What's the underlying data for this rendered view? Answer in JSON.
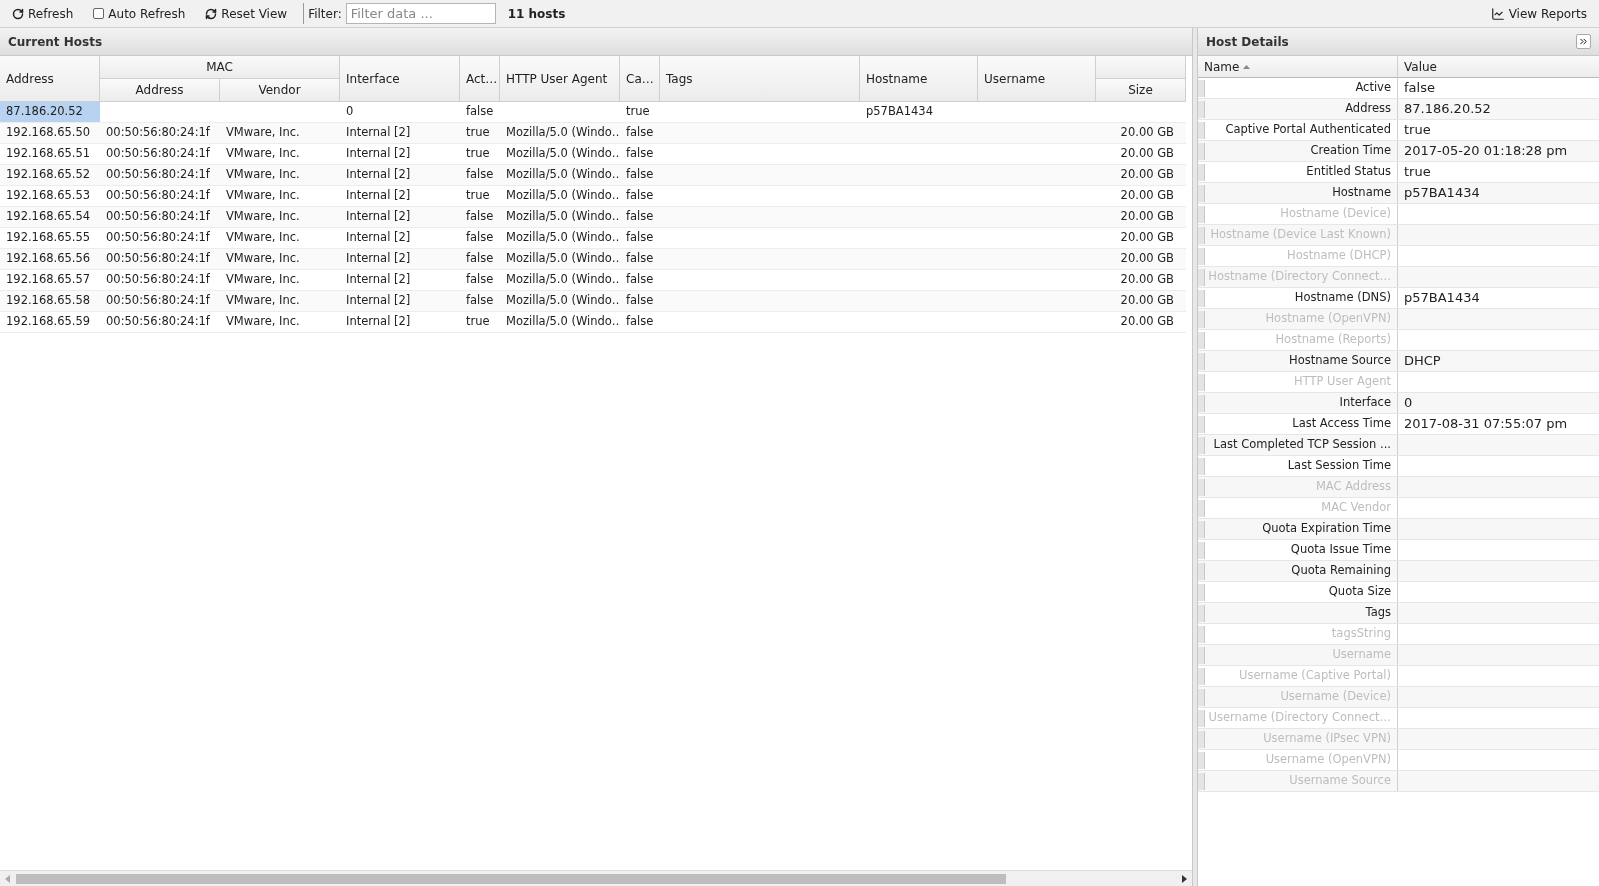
{
  "toolbar": {
    "refresh": "Refresh",
    "auto_refresh": {
      "label": "Auto Refresh",
      "checked": false
    },
    "reset_view": "Reset View",
    "filter_label": "Filter:",
    "filter": {
      "placeholder": "Filter data ..."
    },
    "host_count": "11 hosts",
    "view_reports": "View Reports"
  },
  "hosts_panel": {
    "title": "Current Hosts",
    "column_groups": [
      {
        "label": "MAC"
      }
    ],
    "columns": [
      {
        "label": "Address",
        "kind": "single"
      },
      {
        "label": "Address",
        "kind": "sub"
      },
      {
        "label": "Vendor",
        "kind": "sub"
      },
      {
        "label": "Interface",
        "kind": "single"
      },
      {
        "label": "Act…",
        "kind": "single"
      },
      {
        "label": "HTTP User Agent",
        "kind": "single"
      },
      {
        "label": "Ca…",
        "kind": "single"
      },
      {
        "label": "Tags",
        "kind": "single"
      },
      {
        "label": "Hostname",
        "kind": "single"
      },
      {
        "label": "Username",
        "kind": "single"
      },
      {
        "label": "Size",
        "kind": "sub"
      }
    ],
    "rows": [
      {
        "selected": true,
        "cells": [
          "87.186.20.52",
          "",
          "",
          "0",
          "false",
          "",
          "true",
          "",
          "p57BA1434",
          "",
          ""
        ]
      },
      {
        "selected": false,
        "cells": [
          "192.168.65.50",
          "00:50:56:80:24:1f",
          "VMware, Inc.",
          "Internal [2]",
          "true",
          "Mozilla/5.0 (Windo…",
          "false",
          "",
          "",
          "",
          "20.00 GB"
        ]
      },
      {
        "selected": false,
        "cells": [
          "192.168.65.51",
          "00:50:56:80:24:1f",
          "VMware, Inc.",
          "Internal [2]",
          "true",
          "Mozilla/5.0 (Windo…",
          "false",
          "",
          "",
          "",
          "20.00 GB"
        ]
      },
      {
        "selected": false,
        "cells": [
          "192.168.65.52",
          "00:50:56:80:24:1f",
          "VMware, Inc.",
          "Internal [2]",
          "false",
          "Mozilla/5.0 (Windo…",
          "false",
          "",
          "",
          "",
          "20.00 GB"
        ]
      },
      {
        "selected": false,
        "cells": [
          "192.168.65.53",
          "00:50:56:80:24:1f",
          "VMware, Inc.",
          "Internal [2]",
          "true",
          "Mozilla/5.0 (Windo…",
          "false",
          "",
          "",
          "",
          "20.00 GB"
        ]
      },
      {
        "selected": false,
        "cells": [
          "192.168.65.54",
          "00:50:56:80:24:1f",
          "VMware, Inc.",
          "Internal [2]",
          "false",
          "Mozilla/5.0 (Windo…",
          "false",
          "",
          "",
          "",
          "20.00 GB"
        ]
      },
      {
        "selected": false,
        "cells": [
          "192.168.65.55",
          "00:50:56:80:24:1f",
          "VMware, Inc.",
          "Internal [2]",
          "false",
          "Mozilla/5.0 (Windo…",
          "false",
          "",
          "",
          "",
          "20.00 GB"
        ]
      },
      {
        "selected": false,
        "cells": [
          "192.168.65.56",
          "00:50:56:80:24:1f",
          "VMware, Inc.",
          "Internal [2]",
          "false",
          "Mozilla/5.0 (Windo…",
          "false",
          "",
          "",
          "",
          "20.00 GB"
        ]
      },
      {
        "selected": false,
        "cells": [
          "192.168.65.57",
          "00:50:56:80:24:1f",
          "VMware, Inc.",
          "Internal [2]",
          "false",
          "Mozilla/5.0 (Windo…",
          "false",
          "",
          "",
          "",
          "20.00 GB"
        ]
      },
      {
        "selected": false,
        "cells": [
          "192.168.65.58",
          "00:50:56:80:24:1f",
          "VMware, Inc.",
          "Internal [2]",
          "false",
          "Mozilla/5.0 (Windo…",
          "false",
          "",
          "",
          "",
          "20.00 GB"
        ]
      },
      {
        "selected": false,
        "cells": [
          "192.168.65.59",
          "00:50:56:80:24:1f",
          "VMware, Inc.",
          "Internal [2]",
          "true",
          "Mozilla/5.0 (Windo…",
          "false",
          "",
          "",
          "",
          "20.00 GB"
        ]
      }
    ]
  },
  "details_panel": {
    "title": "Host Details",
    "columns": [
      "Name",
      "Value"
    ],
    "rows": [
      {
        "name": "Active",
        "value": "false",
        "disabled": false
      },
      {
        "name": "Address",
        "value": "87.186.20.52",
        "disabled": false
      },
      {
        "name": "Captive Portal Authenticated",
        "value": "true",
        "disabled": false
      },
      {
        "name": "Creation Time",
        "value": "2017-05-20 01:18:28 pm",
        "disabled": false
      },
      {
        "name": "Entitled Status",
        "value": "true",
        "disabled": false
      },
      {
        "name": "Hostname",
        "value": "p57BA1434",
        "disabled": false
      },
      {
        "name": "Hostname (Device)",
        "disabled": true
      },
      {
        "name": "Hostname (Device Last Known)",
        "disabled": true
      },
      {
        "name": "Hostname (DHCP)",
        "disabled": true
      },
      {
        "name": "Hostname (Directory Connect…",
        "disabled": true
      },
      {
        "name": "Hostname (DNS)",
        "value": "p57BA1434",
        "disabled": false
      },
      {
        "name": "Hostname (OpenVPN)",
        "disabled": true
      },
      {
        "name": "Hostname (Reports)",
        "disabled": true
      },
      {
        "name": "Hostname Source",
        "value": "DHCP",
        "disabled": false
      },
      {
        "name": "HTTP User Agent",
        "disabled": true
      },
      {
        "name": "Interface",
        "value": "0",
        "disabled": false
      },
      {
        "name": "Last Access Time",
        "value": "2017-08-31 07:55:07 pm",
        "disabled": false
      },
      {
        "name": "Last Completed TCP Session ...",
        "disabled": false
      },
      {
        "name": "Last Session Time",
        "disabled": false
      },
      {
        "name": "MAC Address",
        "disabled": true
      },
      {
        "name": "MAC Vendor",
        "disabled": true
      },
      {
        "name": "Quota Expiration Time",
        "disabled": false
      },
      {
        "name": "Quota Issue Time",
        "disabled": false
      },
      {
        "name": "Quota Remaining",
        "disabled": false
      },
      {
        "name": "Quota Size",
        "disabled": false
      },
      {
        "name": "Tags",
        "disabled": false
      },
      {
        "name": "tagsString",
        "disabled": true
      },
      {
        "name": "Username",
        "disabled": true
      },
      {
        "name": "Username (Captive Portal)",
        "disabled": true
      },
      {
        "name": "Username (Device)",
        "disabled": true
      },
      {
        "name": "Username (Directory Connect…",
        "disabled": true
      },
      {
        "name": "Username (IPsec VPN)",
        "disabled": true
      },
      {
        "name": "Username (OpenVPN)",
        "disabled": true
      },
      {
        "name": "Username Source",
        "disabled": true
      }
    ]
  }
}
